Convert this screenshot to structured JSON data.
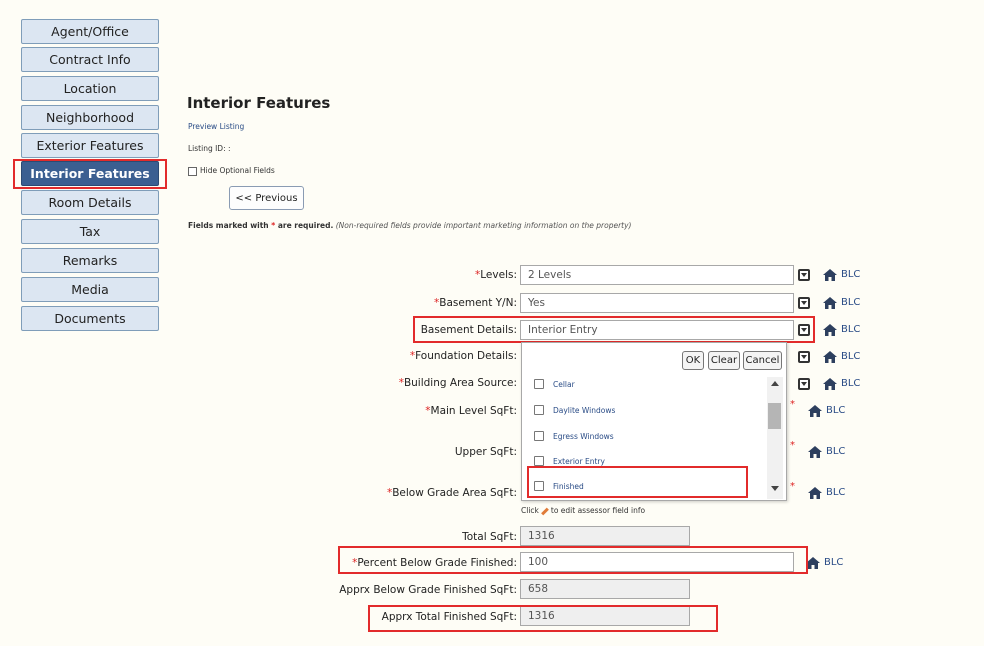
{
  "sidebar": {
    "items": [
      {
        "label": "Agent/Office"
      },
      {
        "label": "Contract Info"
      },
      {
        "label": "Location"
      },
      {
        "label": "Neighborhood"
      },
      {
        "label": "Exterior Features"
      },
      {
        "label": "Interior Features"
      },
      {
        "label": "Room Details"
      },
      {
        "label": "Tax"
      },
      {
        "label": "Remarks"
      },
      {
        "label": "Media"
      },
      {
        "label": "Documents"
      }
    ],
    "active": "Interior Features"
  },
  "header": {
    "title": "Interior Features",
    "preview_link": "Preview Listing",
    "listing_id": "Listing ID: :",
    "hide_optional": "Hide Optional Fields",
    "previous_button": "<< Previous",
    "required_note_a": "Fields marked with ",
    "required_star": "*",
    "required_note_b": " are required.",
    "required_note_c": "(Non-required fields provide important marketing information on the property)"
  },
  "form": {
    "levels": {
      "label": "Levels:",
      "value": "2 Levels"
    },
    "basement_yn": {
      "label": "Basement Y/N:",
      "value": "Yes"
    },
    "basement_details": {
      "label": "Basement Details:",
      "value": "Interior Entry"
    },
    "foundation_details": {
      "label": "Foundation Details:"
    },
    "building_area_source": {
      "label": "Building Area Source:"
    },
    "main_level_sqft": {
      "label": "Main Level SqFt:"
    },
    "upper_sqft": {
      "label": "Upper SqFt:"
    },
    "below_grade_area_sqft": {
      "label": "Below Grade Area SqFt:"
    },
    "assessor_note_a": "Click",
    "assessor_note_b": "to edit assessor field info",
    "total_sqft": {
      "label": "Total SqFt:",
      "value": "1316"
    },
    "percent_below_grade_finished": {
      "label": "Percent Below Grade Finished:",
      "value": "100"
    },
    "apprx_below_grade_finished_sqft": {
      "label": "Apprx Below Grade Finished SqFt:",
      "value": "658"
    },
    "apprx_total_finished_sqft": {
      "label": "Apprx Total Finished SqFt:",
      "value": "1316"
    },
    "required_star": "*",
    "blc_label": "BLC"
  },
  "dropdown": {
    "ok": "OK",
    "clear": "Clear",
    "cancel": "Cancel",
    "options": [
      "Cellar",
      "Daylite Windows",
      "Egress Windows",
      "Exterior Entry",
      "Finished"
    ]
  },
  "colors": {
    "active_nav": "#3b5f91",
    "nav_bg": "#dce6f2",
    "highlight": "#e22b2b",
    "link": "#2a4c86",
    "required": "#d22222"
  }
}
